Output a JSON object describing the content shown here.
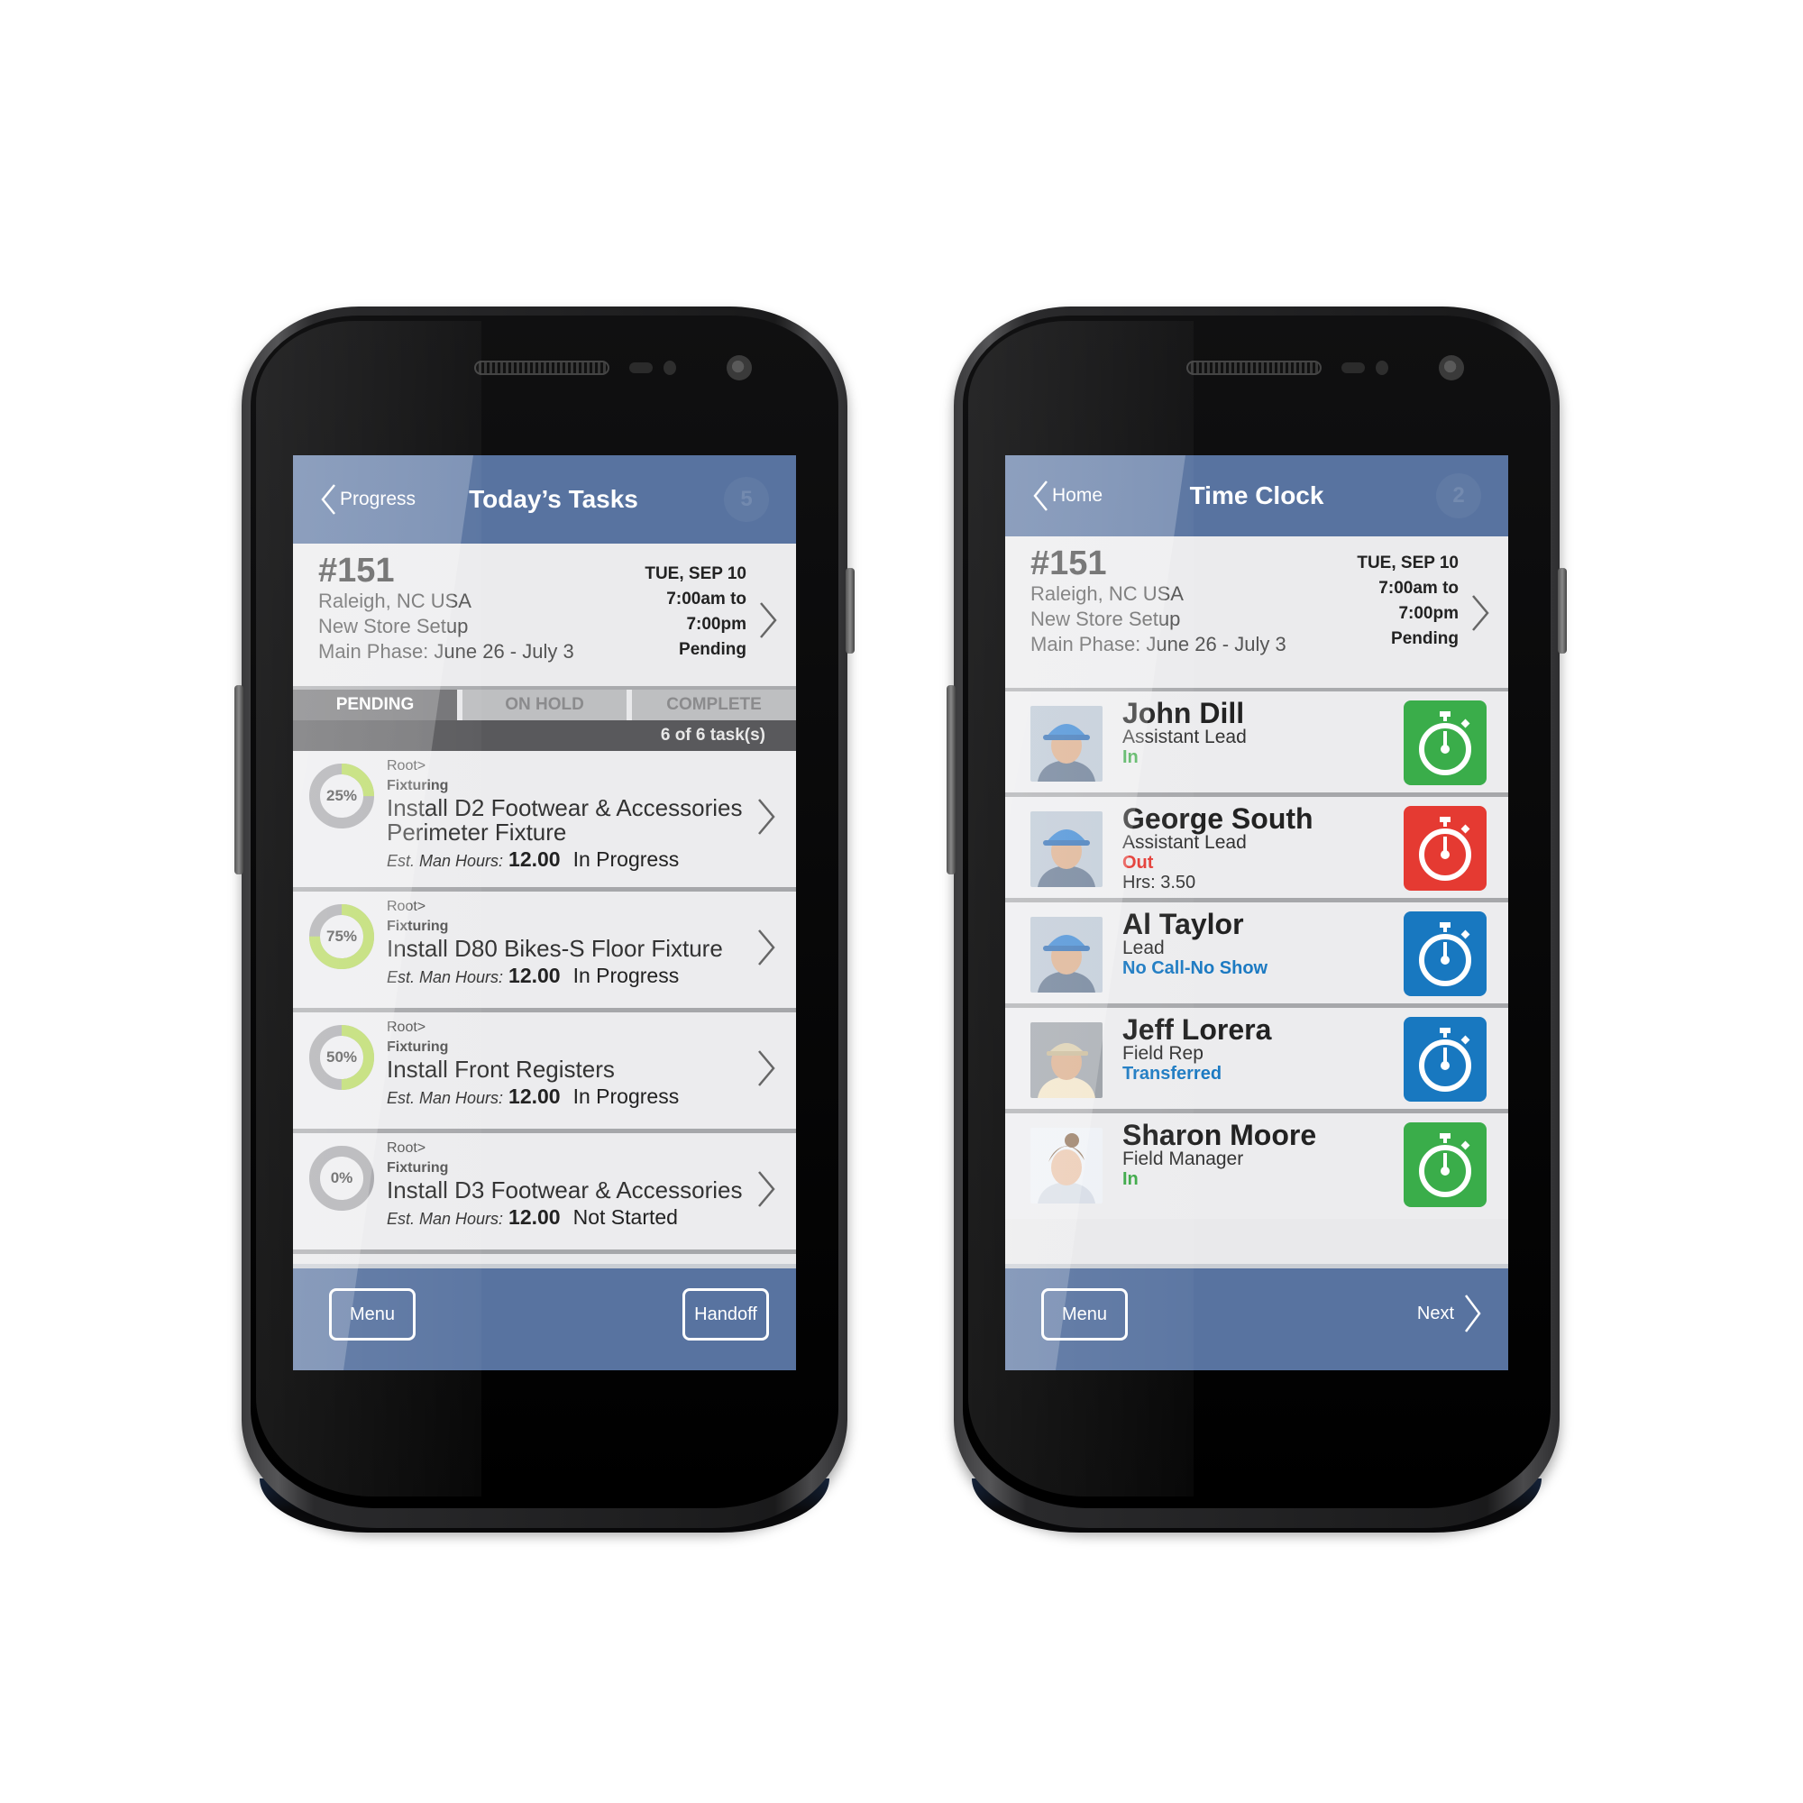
{
  "colors": {
    "header_blue": "#5873a0",
    "ring_progress": "#b5d85a",
    "ring_track": "#a6a6aa",
    "status_in": "#3aa845",
    "status_out": "#e43b35",
    "status_info": "#1c7ac2",
    "clock_green": "#3aad4a",
    "clock_red": "#e53a32",
    "clock_blue": "#1878c0"
  },
  "tasks_screen": {
    "header": {
      "back_label": "Progress",
      "title": "Today’s Tasks",
      "badge": "5"
    },
    "job": {
      "number": "#151",
      "location": "Raleigh, NC  USA",
      "type": "New Store Setup",
      "phase": "Main Phase: June 26 - July 3",
      "date": "TUE, SEP 10",
      "time_start": "7:00am to",
      "time_end": "7:00pm",
      "status": "Pending"
    },
    "tabs": [
      {
        "label": "PENDING",
        "active": true
      },
      {
        "label": "ON HOLD",
        "active": false
      },
      {
        "label": "COMPLETE",
        "active": false
      }
    ],
    "count_label": "6 of 6 task(s)",
    "tasks": [
      {
        "percent": 25,
        "percent_label": "25%",
        "path": "Root>",
        "category": "Fixturing",
        "name": "Install D2 Footwear & Accessories Perimeter Fixture",
        "hours_label": "Est. Man Hours:",
        "hours": "12.00",
        "status": "In Progress"
      },
      {
        "percent": 75,
        "percent_label": "75%",
        "path": "Root>",
        "category": "Fixturing",
        "name": "Install D80 Bikes-S Floor Fixture",
        "hours_label": "Est. Man Hours:",
        "hours": "12.00",
        "status": "In Progress"
      },
      {
        "percent": 50,
        "percent_label": "50%",
        "path": "Root>",
        "category": "Fixturing",
        "name": "Install Front Registers",
        "hours_label": "Est. Man Hours:",
        "hours": "12.00",
        "status": "In Progress"
      },
      {
        "percent": 0,
        "percent_label": "0%",
        "path": "Root>",
        "category": "Fixturing",
        "name": "Install D3 Footwear & Accessories",
        "hours_label": "Est. Man Hours:",
        "hours": "12.00",
        "status": "Not Started"
      }
    ],
    "footer": {
      "menu_label": "Menu",
      "handoff_label": "Handoff"
    }
  },
  "timeclock_screen": {
    "header": {
      "back_label": "Home",
      "title": "Time Clock",
      "badge": "2"
    },
    "job": {
      "number": "#151",
      "location": "Raleigh, NC  USA",
      "type": "New Store Setup",
      "phase": "Main Phase: June 26 - July 3",
      "date": "TUE, SEP 10",
      "time_start": "7:00am to",
      "time_end": "7:00pm",
      "status": "Pending"
    },
    "employees": [
      {
        "name": "John Dill",
        "role": "Assistant Lead",
        "status": "In",
        "status_color": "#3aa845",
        "hours": "",
        "clock_color": "#3aad4a",
        "avatar": "hardhat-blue"
      },
      {
        "name": "George South",
        "role": "Assistant Lead",
        "status": "Out",
        "status_color": "#e43b35",
        "hours": "Hrs: 3.50",
        "clock_color": "#e53a32",
        "avatar": "hardhat-blue"
      },
      {
        "name": "Al Taylor",
        "role": "Lead",
        "status": "No Call-No Show",
        "status_color": "#1c7ac2",
        "hours": "",
        "clock_color": "#1878c0",
        "avatar": "hardhat-blue"
      },
      {
        "name": "Jeff Lorera",
        "role": "Field Rep",
        "status": "Transferred",
        "status_color": "#1c7ac2",
        "hours": "",
        "clock_color": "#1878c0",
        "avatar": "cap-beige"
      },
      {
        "name": "Sharon Moore",
        "role": "Field Manager",
        "status": "In",
        "status_color": "#3aa845",
        "hours": "",
        "clock_color": "#3aad4a",
        "avatar": "woman"
      }
    ],
    "footer": {
      "menu_label": "Menu",
      "next_label": "Next"
    }
  }
}
